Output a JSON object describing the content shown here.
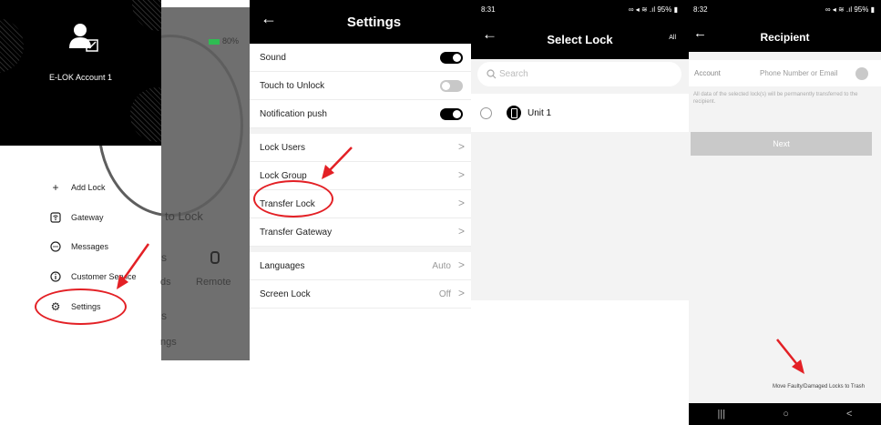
{
  "drawer": {
    "account_name": "E-LOK Account 1",
    "items": [
      {
        "icon": "plus-icon",
        "label": "Add Lock"
      },
      {
        "icon": "gateway-icon",
        "label": "Gateway"
      },
      {
        "icon": "message-icon",
        "label": "Messages"
      },
      {
        "icon": "info-icon",
        "label": "Customer Service"
      },
      {
        "icon": "gear-icon",
        "label": "Settings"
      }
    ],
    "background": {
      "battery": "80%",
      "unlock_text": "to Lock",
      "nav_left": "ds",
      "nav_right": "Remote",
      "bottom_text": "ngs",
      "frag_a": "s",
      "frag_b": "s"
    }
  },
  "settings": {
    "title": "Settings",
    "group1": [
      {
        "label": "Sound",
        "toggle": "on"
      },
      {
        "label": "Touch to Unlock",
        "toggle": "off"
      },
      {
        "label": "Notification push",
        "toggle": "on"
      }
    ],
    "group2": [
      {
        "label": "Lock Users"
      },
      {
        "label": "Lock Group"
      },
      {
        "label": "Transfer Lock"
      },
      {
        "label": "Transfer Gateway"
      }
    ],
    "group3": [
      {
        "label": "Languages",
        "value": "Auto"
      },
      {
        "label": "Screen Lock",
        "value": "Off"
      }
    ]
  },
  "select_lock": {
    "status_time": "8:31",
    "status_right": "95%",
    "title": "Select Lock",
    "all_label": "All",
    "search_placeholder": "Search",
    "lock_name": "Unit 1"
  },
  "recipient": {
    "status_time": "8:32",
    "status_right": "95%",
    "title": "Recipient",
    "account_label": "Account",
    "account_placeholder": "Phone Number or Email",
    "note": "All data of the selected lock(s) will be permanently transferred to the recipient.",
    "next_label": "Next",
    "trash_link": "Move Faulty/Damaged Locks to Trash",
    "nav_recent": "|||",
    "nav_home": "○",
    "nav_back": "<"
  },
  "colors": {
    "accent": "#000000",
    "annotation": "#e32025",
    "toggle_off": "#c8c8c8",
    "battery": "#2fbd52"
  }
}
